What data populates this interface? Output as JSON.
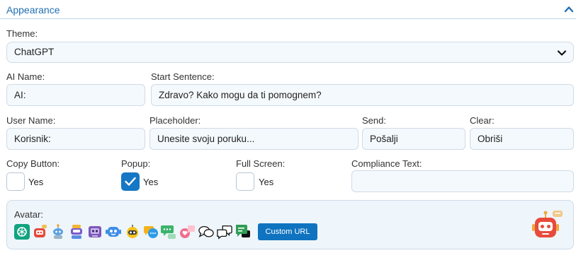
{
  "section": {
    "title": "Appearance"
  },
  "theme": {
    "label": "Theme:",
    "value": "ChatGPT"
  },
  "ai_name": {
    "label": "AI Name:",
    "value": "AI:"
  },
  "start_sentence": {
    "label": "Start Sentence:",
    "value": "Zdravo? Kako mogu da ti pomognem?"
  },
  "user_name": {
    "label": "User Name:",
    "value": "Korisnik:"
  },
  "placeholder": {
    "label": "Placeholder:",
    "value": "Unesite svoju poruku..."
  },
  "send": {
    "label": "Send:",
    "value": "Pošalji"
  },
  "clear": {
    "label": "Clear:",
    "value": "Obriši"
  },
  "copy_button": {
    "label": "Copy Button:",
    "option": "Yes",
    "checked": false
  },
  "popup": {
    "label": "Popup:",
    "option": "Yes",
    "checked": true
  },
  "full_screen": {
    "label": "Full Screen:",
    "option": "Yes",
    "checked": false
  },
  "compliance_text": {
    "label": "Compliance Text:",
    "value": ""
  },
  "avatar": {
    "label": "Avatar:",
    "custom_url_label": "Custom URL",
    "icons": [
      "chatgpt-logo-icon",
      "robot-red-icon",
      "robot-antenna-icon",
      "robot-purple-icon",
      "robot-square-icon",
      "robot-blue-icon",
      "robot-yellow-icon",
      "chat-bubbles-color-icon",
      "chat-green-icon",
      "chat-heart-icon",
      "chat-outline-icon",
      "chat-outline-double-icon",
      "chat-green-lines-icon"
    ],
    "selected_preview": "robot-red-preview-icon"
  },
  "colors": {
    "accent": "#1f6fb2",
    "button": "#0f73bf",
    "field_bg": "#f4f9fd",
    "border": "#cfdbe7"
  }
}
